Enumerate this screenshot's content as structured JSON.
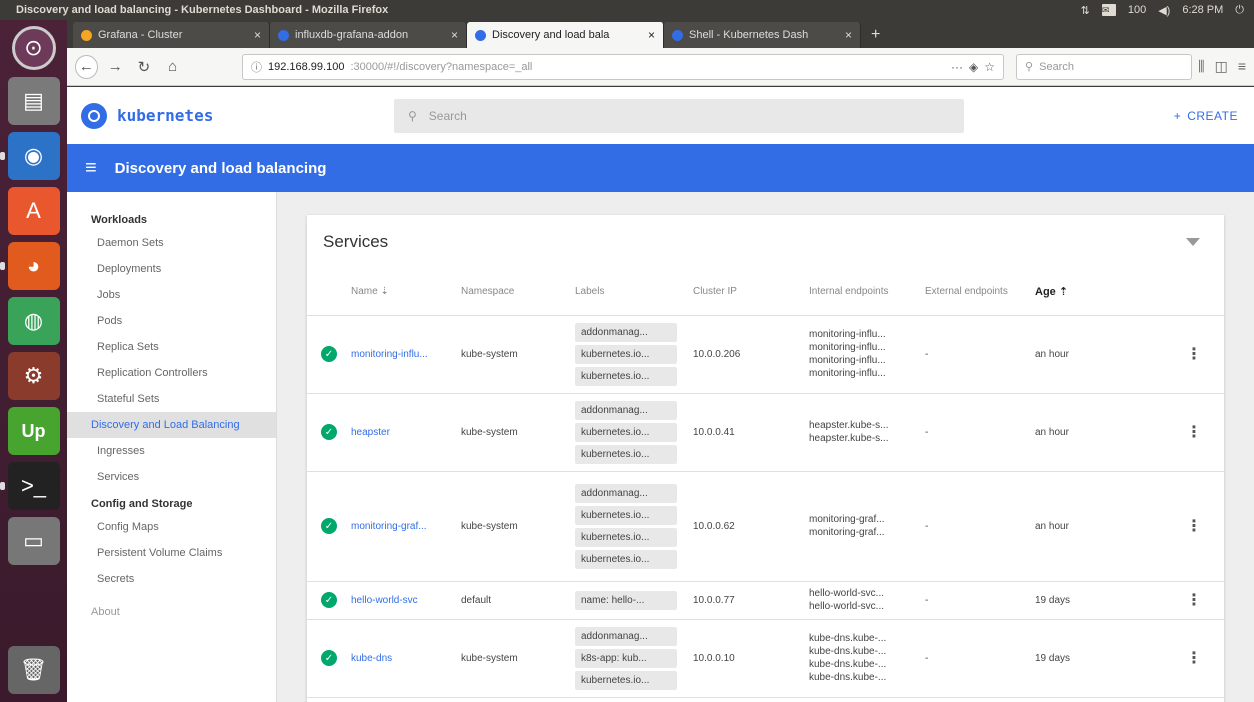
{
  "window_title": "Discovery and load balancing - Kubernetes Dashboard - Mozilla Firefox",
  "system": {
    "clock": "6:28 PM",
    "sound": "◀)",
    "battery": "100"
  },
  "tabs": [
    {
      "label": "Grafana - Cluster",
      "color": "#f5a623"
    },
    {
      "label": "influxdb-grafana-addon",
      "color": "#326de6"
    },
    {
      "label": "Discovery and load bala",
      "color": "#326de6"
    },
    {
      "label": "Shell - Kubernetes Dash",
      "color": "#326de6"
    }
  ],
  "url": {
    "host": "192.168.99.100",
    "path": ":30000/#!/discovery?namespace=_all",
    "search_placeholder": "Search"
  },
  "k8s": {
    "brand": "kubernetes",
    "search_placeholder": "Search",
    "create_label": "CREATE",
    "page_title": "Discovery and load balancing"
  },
  "sidebar": {
    "workloads": "Workloads",
    "workload_items": [
      "Daemon Sets",
      "Deployments",
      "Jobs",
      "Pods",
      "Replica Sets",
      "Replication Controllers",
      "Stateful Sets"
    ],
    "discovery": "Discovery and Load Balancing",
    "discovery_items": [
      "Ingresses",
      "Services"
    ],
    "config": "Config and Storage",
    "config_items": [
      "Config Maps",
      "Persistent Volume Claims",
      "Secrets"
    ],
    "about": "About"
  },
  "services": {
    "title": "Services",
    "headers": {
      "name": "Name ⇣",
      "namespace": "Namespace",
      "labels": "Labels",
      "cluster_ip": "Cluster IP",
      "internal": "Internal endpoints",
      "external": "External endpoints",
      "age": "Age ⇡"
    },
    "rows": [
      {
        "name": "monitoring-influ...",
        "namespace": "kube-system",
        "labels": [
          "addonmanag...",
          "kubernetes.io...",
          "kubernetes.io..."
        ],
        "ip": "10.0.0.206",
        "internal": [
          "monitoring-influ...",
          "monitoring-influ...",
          "monitoring-influ...",
          "monitoring-influ..."
        ],
        "external": "-",
        "age": "an hour"
      },
      {
        "name": "heapster",
        "namespace": "kube-system",
        "labels": [
          "addonmanag...",
          "kubernetes.io...",
          "kubernetes.io..."
        ],
        "ip": "10.0.0.41",
        "internal": [
          "heapster.kube-s...",
          "heapster.kube-s..."
        ],
        "external": "-",
        "age": "an hour"
      },
      {
        "name": "monitoring-graf...",
        "namespace": "kube-system",
        "labels": [
          "addonmanag...",
          "kubernetes.io...",
          "kubernetes.io...",
          "kubernetes.io..."
        ],
        "ip": "10.0.0.62",
        "internal": [
          "monitoring-graf...",
          "monitoring-graf..."
        ],
        "external": "-",
        "age": "an hour"
      },
      {
        "name": "hello-world-svc",
        "namespace": "default",
        "labels": [
          "name: hello-..."
        ],
        "ip": "10.0.0.77",
        "internal": [
          "hello-world-svc...",
          "hello-world-svc..."
        ],
        "external": "-",
        "age": "19 days"
      },
      {
        "name": "kube-dns",
        "namespace": "kube-system",
        "labels": [
          "addonmanag...",
          "k8s-app: kub...",
          "kubernetes.io..."
        ],
        "ip": "10.0.0.10",
        "internal": [
          "kube-dns.kube-...",
          "kube-dns.kube-...",
          "kube-dns.kube-...",
          "kube-dns.kube-..."
        ],
        "external": "-",
        "age": "19 days"
      }
    ]
  },
  "colors": {
    "brand_blue": "#326de6",
    "status_ok": "#00a86b",
    "launcher": "#4b2238"
  }
}
